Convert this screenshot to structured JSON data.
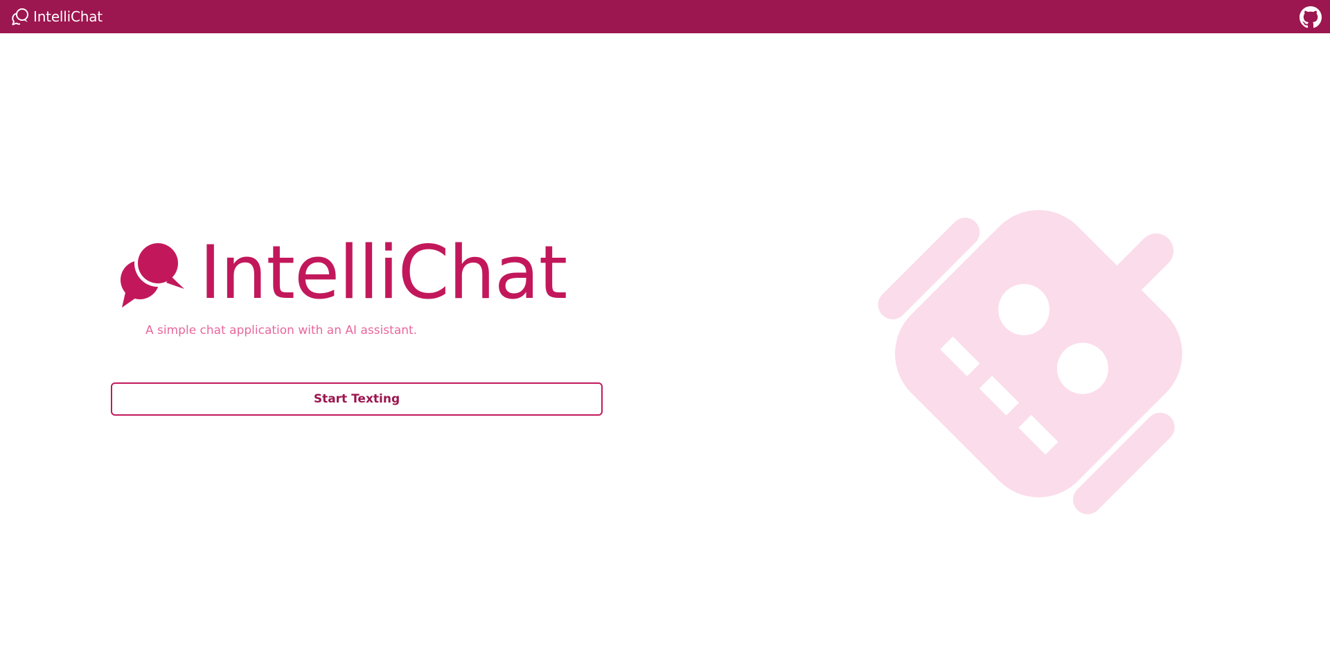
{
  "navbar": {
    "brand_title": "IntelliChat",
    "brand_icon": "chat-bubbles-icon",
    "github_icon": "github-icon",
    "github_label": "GitHub"
  },
  "hero": {
    "logo_icon": "chat-bubbles-icon",
    "title": "IntelliChat",
    "tagline": "A simple chat application with an AI assistant.",
    "cta_label": "Start Texting",
    "illustration_icon": "robot-icon"
  },
  "colors": {
    "navbar_bg": "#9c164f",
    "brand": "#c2185b",
    "tagline": "#e8669c",
    "illustration": "#fbdcea",
    "background": "#ffffff"
  }
}
